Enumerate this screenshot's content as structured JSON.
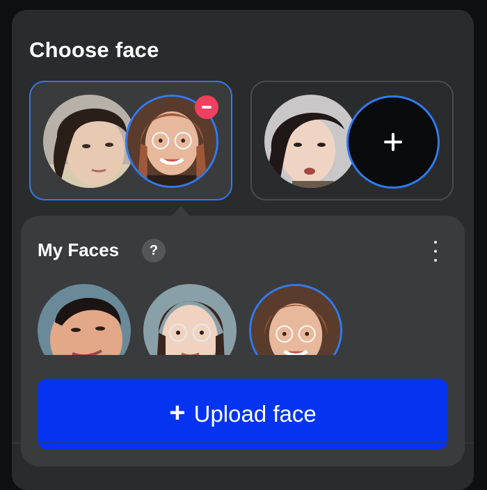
{
  "header": {
    "title": "Choose face"
  },
  "my_faces": {
    "title": "My Faces",
    "help_glyph": "?",
    "upload_label": "Upload face",
    "upload_glyph": "+"
  },
  "icons": {
    "remove": "minus-icon",
    "add": "plus-icon",
    "help": "question-icon",
    "more": "more-vertical-icon"
  },
  "colors": {
    "panel_bg": "#2a2b2c",
    "popover_bg": "#3a3b3d",
    "accent_blue": "#2f7bf2",
    "upload_blue": "#0534f0",
    "remove_red": "#f0405f"
  },
  "face_pairs": [
    {
      "state": "selected",
      "source": "woman-glasses-smiling",
      "target": "woman-short-hair"
    },
    {
      "state": "unselected",
      "source": "empty",
      "target": "woman-talking"
    }
  ],
  "library": [
    {
      "subject": "boy-short-hair",
      "selected": false
    },
    {
      "subject": "woman-glasses",
      "selected": false
    },
    {
      "subject": "woman-glasses-smiling",
      "selected": true
    }
  ]
}
